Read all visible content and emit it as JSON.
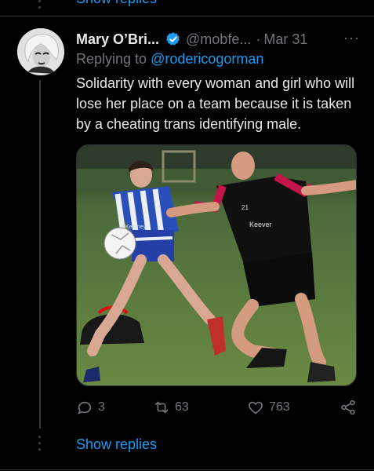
{
  "top": {
    "show_replies_label": "Show replies"
  },
  "tweet": {
    "author_name": "Mary O’Bri...",
    "handle": "@mobfe...",
    "separator": "·",
    "date": "Mar 31",
    "more_icon": "more-horizontal-icon",
    "replying_prefix": "Replying to",
    "replying_to": "@rodericogorman",
    "text": "Solidarity with every woman and girl who will lose her place on a team because it is taken by a cheating trans identifying male.",
    "media_description_shirt_number": "21",
    "media_shirt_text_left": "Kearney",
    "media_shirt_text_right": "Keever"
  },
  "actions": {
    "reply_count": "3",
    "retweet_count": "63",
    "like_count": "763"
  },
  "bottom": {
    "show_replies_label": "Show replies"
  },
  "colors": {
    "background": "#000000",
    "text": "#e7e9ea",
    "muted": "#71767b",
    "accent": "#1d9bf0"
  }
}
